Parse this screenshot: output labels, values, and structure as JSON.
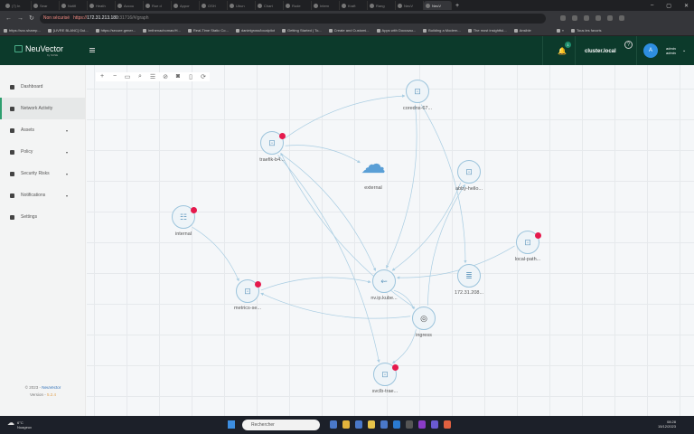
{
  "browser": {
    "tabs": [
      "(7) In",
      "Sear",
      "Notifi",
      "Heath",
      "Accou",
      "Rue d",
      "Appor",
      "OSH",
      "Ubun",
      "Chart",
      "Rude",
      "Intern",
      "Kraft",
      "Rang",
      "NeuV",
      "NeuV"
    ],
    "active_tab": 15,
    "new_tab": "+",
    "security_label": "Non sécurisé",
    "url_scheme": "https://",
    "url_host": "172.31.213.180",
    "url_rest": ":31716/#/graph",
    "bookmarks": [
      "https://svc.sharep...",
      "[LIVRE BLANC] Gui...",
      "https://secure.gener...",
      "imthenachoman/H...",
      "Real-Time Static Co...",
      "danielgross/localpilot",
      "Getting Started | To...",
      "Create and Customi...",
      "Apps with Docusau...",
      "Building a Modern...",
      "The most insightful...",
      "Ansible",
      "»",
      "Tous les favoris"
    ]
  },
  "header": {
    "brand": "NeuVector",
    "brand_sub": "by SUSE",
    "notification_count": "1",
    "cluster": "cluster.local",
    "help": "?",
    "avatar": "A",
    "user_name": "admin",
    "user_role": "admin"
  },
  "sidebar": {
    "items": [
      {
        "label": "Dashboard",
        "icon": "dashboard-icon"
      },
      {
        "label": "Network Activity",
        "icon": "network-icon",
        "active": true
      },
      {
        "label": "Assets",
        "icon": "assets-icon",
        "expandable": true
      },
      {
        "label": "Policy",
        "icon": "policy-icon",
        "expandable": true
      },
      {
        "label": "Security Risks",
        "icon": "security-icon",
        "expandable": true
      },
      {
        "label": "Notifications",
        "icon": "bell-icon",
        "expandable": true
      },
      {
        "label": "Settings",
        "icon": "gear-icon"
      }
    ],
    "copyright": "© 2023 - ",
    "copyright_link": "NeuVector",
    "version_label": "Version - ",
    "version": "5.2.4"
  },
  "toolbar": [
    "zoom-in",
    "zoom-out",
    "fit",
    "search",
    "filter",
    "hide",
    "snapshot",
    "export",
    "refresh"
  ],
  "graph": {
    "nodes": [
      {
        "id": "coredns",
        "label": "coredns-67...",
        "type": "service",
        "alert": false
      },
      {
        "id": "traefik",
        "label": "traefik-b4...",
        "type": "service",
        "alert": true
      },
      {
        "id": "external",
        "label": "external",
        "type": "cloud",
        "alert": false
      },
      {
        "id": "abby",
        "label": "abby-hello...",
        "type": "service",
        "alert": false
      },
      {
        "id": "internal",
        "label": "internal",
        "type": "host",
        "alert": true
      },
      {
        "id": "localpath",
        "label": "local-path...",
        "type": "service",
        "alert": true
      },
      {
        "id": "ip172",
        "label": "172.31.208...",
        "type": "server",
        "alert": false
      },
      {
        "id": "nvip",
        "label": "nv.ip.kube...",
        "type": "ip",
        "alert": false
      },
      {
        "id": "metrics",
        "label": "metrics-se...",
        "type": "service",
        "alert": true
      },
      {
        "id": "ingress",
        "label": "ingress",
        "type": "ingress",
        "alert": false
      },
      {
        "id": "svclb",
        "label": "svclb-trae...",
        "type": "service",
        "alert": true
      }
    ],
    "edges": [
      [
        "traefik",
        "coredns"
      ],
      [
        "traefik",
        "external"
      ],
      [
        "traefik",
        "nvip"
      ],
      [
        "traefik",
        "svclb"
      ],
      [
        "coredns",
        "nvip"
      ],
      [
        "coredns",
        "ip172"
      ],
      [
        "abby",
        "nvip"
      ],
      [
        "localpath",
        "nvip"
      ],
      [
        "internal",
        "metrics"
      ],
      [
        "metrics",
        "nvip"
      ],
      [
        "ingress",
        "metrics"
      ],
      [
        "ingress",
        "svclb"
      ],
      [
        "ingress",
        "abby"
      ],
      [
        "nvip",
        "ingress"
      ],
      [
        "ingress",
        "traefik"
      ]
    ],
    "edge_color": "#a9cde2",
    "alert_color": "#e5194c"
  },
  "taskbar": {
    "temp": "6°C",
    "weather": "Nuageux",
    "search_placeholder": "Rechercher",
    "time": "08:28",
    "date": "15/12/2023"
  }
}
